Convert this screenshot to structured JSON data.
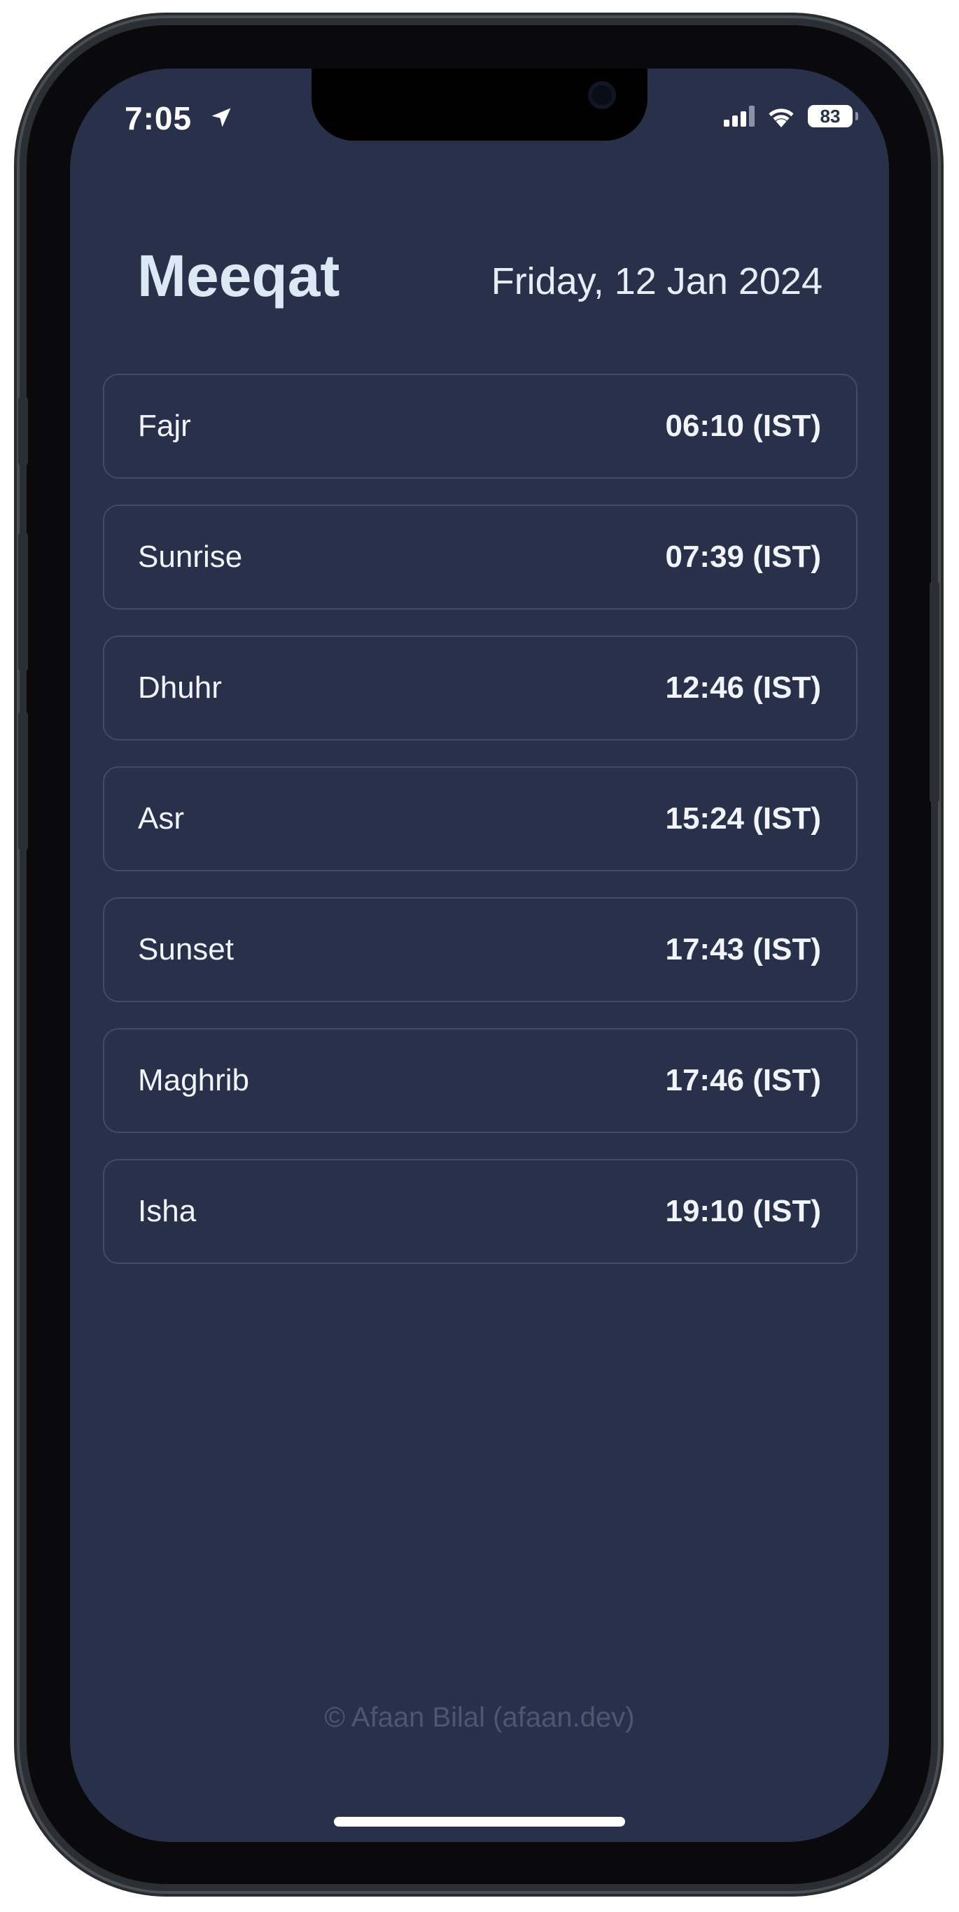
{
  "status_bar": {
    "time": "7:05",
    "location_icon": "location-arrow-icon",
    "signal_icon": "cellular-signal-icon",
    "wifi_icon": "wifi-icon",
    "battery_level": "83"
  },
  "header": {
    "title": "Meeqat",
    "date": "Friday, 12 Jan 2024"
  },
  "prayers": [
    {
      "name": "Fajr",
      "time": "06:10 (IST)"
    },
    {
      "name": "Sunrise",
      "time": "07:39 (IST)"
    },
    {
      "name": "Dhuhr",
      "time": "12:46 (IST)"
    },
    {
      "name": "Asr",
      "time": "15:24 (IST)"
    },
    {
      "name": "Sunset",
      "time": "17:43 (IST)"
    },
    {
      "name": "Maghrib",
      "time": "17:46 (IST)"
    },
    {
      "name": "Isha",
      "time": "19:10 (IST)"
    }
  ],
  "footer": {
    "credit": "© Afaan Bilal (afaan.dev)"
  },
  "colors": {
    "background": "#29304a",
    "title": "#dbe9f7",
    "row_border": "#414a66",
    "footer_text": "#4c5675"
  }
}
